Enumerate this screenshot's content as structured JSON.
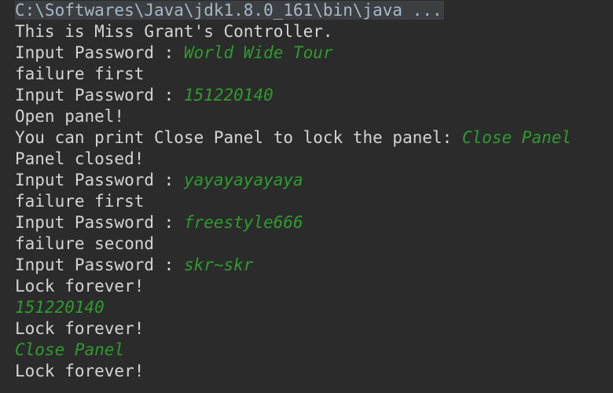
{
  "console": {
    "command": "C:\\Softwares\\Java\\jdk1.8.0_161\\bin\\java ...",
    "lines": [
      {
        "text": "This is Miss Grant's Controller.",
        "input": ""
      },
      {
        "text": "Input Password : ",
        "input": "World Wide Tour"
      },
      {
        "text": "failure first",
        "input": ""
      },
      {
        "text": "Input Password : ",
        "input": "151220140"
      },
      {
        "text": "Open panel!",
        "input": ""
      },
      {
        "text": "You can print Close Panel to lock the panel: ",
        "input": "Close Panel"
      },
      {
        "text": "Panel closed!",
        "input": ""
      },
      {
        "text": "Input Password : ",
        "input": "yayayayayaya"
      },
      {
        "text": "failure first",
        "input": ""
      },
      {
        "text": "Input Password : ",
        "input": "freestyle666"
      },
      {
        "text": "failure second",
        "input": ""
      },
      {
        "text": "Input Password : ",
        "input": "skr~skr"
      },
      {
        "text": "Lock forever!",
        "input": ""
      },
      {
        "text": "",
        "input": "151220140"
      },
      {
        "text": "Lock forever!",
        "input": ""
      },
      {
        "text": "",
        "input": "Close Panel"
      },
      {
        "text": "Lock forever!",
        "input": ""
      }
    ]
  },
  "colors": {
    "background": "#2b2b2b",
    "output_text": "#d4d4d4",
    "user_input": "#2e9b2e"
  }
}
